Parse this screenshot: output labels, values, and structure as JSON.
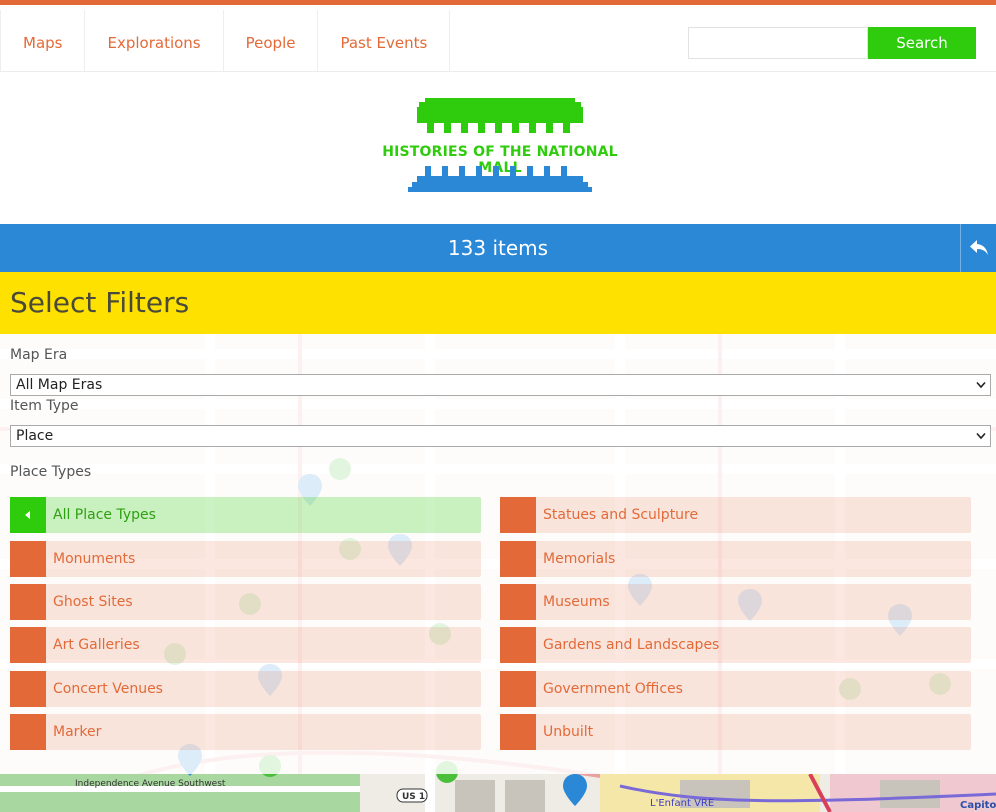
{
  "nav": {
    "items": [
      {
        "label": "Maps"
      },
      {
        "label": "Explorations"
      },
      {
        "label": "People"
      },
      {
        "label": "Past Events"
      }
    ]
  },
  "search": {
    "value": "",
    "placeholder": "",
    "button_label": "Search"
  },
  "logo": {
    "title": "HISTORIES OF THE NATIONAL MALL"
  },
  "items_bar": {
    "count_label": "133 items"
  },
  "filters": {
    "title": "Select Filters",
    "map_era": {
      "label": "Map Era",
      "selected": "All Map Eras"
    },
    "item_type": {
      "label": "Item Type",
      "selected": "Place"
    },
    "place_types": {
      "label": "Place Types",
      "items": [
        {
          "label": "All Place Types",
          "active": true
        },
        {
          "label": "Statues and Sculpture"
        },
        {
          "label": "Monuments"
        },
        {
          "label": "Memorials"
        },
        {
          "label": "Ghost Sites"
        },
        {
          "label": "Museums"
        },
        {
          "label": "Art Galleries"
        },
        {
          "label": "Gardens and Landscapes"
        },
        {
          "label": "Concert Venues"
        },
        {
          "label": "Government Offices"
        },
        {
          "label": "Marker"
        },
        {
          "label": "Unbuilt"
        }
      ]
    }
  },
  "map": {
    "labels": {
      "street_1": "Independence Avenue Southwest",
      "shield": "US 1",
      "station": "L'Enfant VRE",
      "capitol": "Capito"
    }
  },
  "colors": {
    "accent": "#e36a38",
    "green": "#2ecc0c",
    "blue": "#2a88d6",
    "yellow": "#ffe100"
  }
}
